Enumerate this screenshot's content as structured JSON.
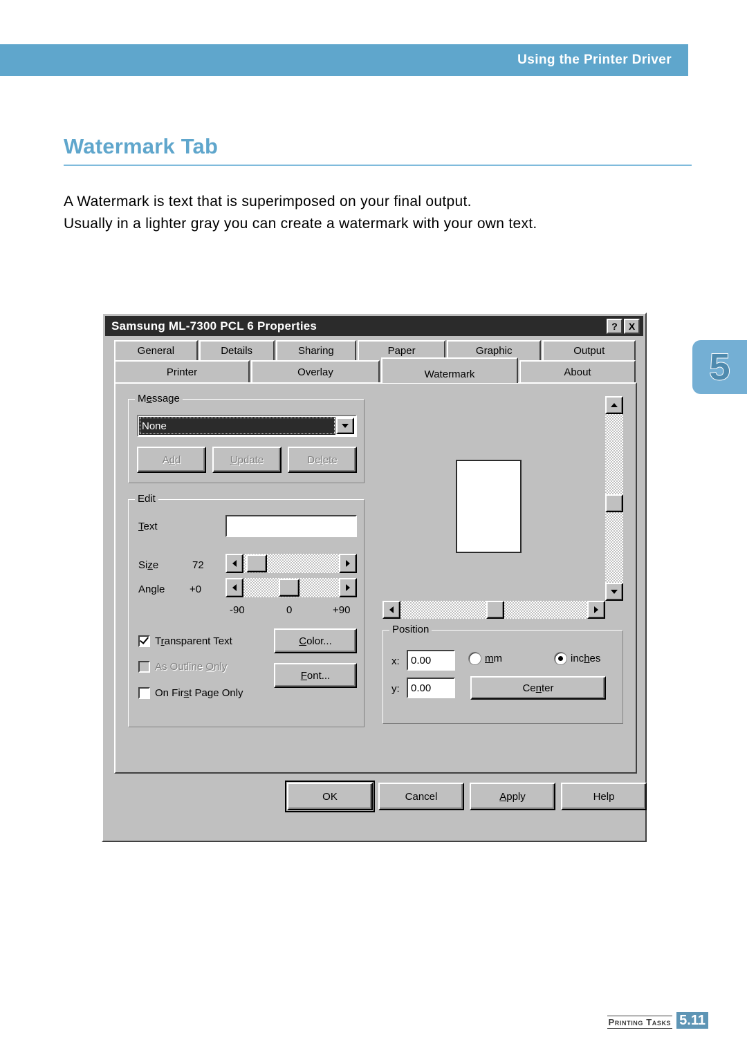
{
  "header": {
    "title": "Using the Printer Driver"
  },
  "page": {
    "title": "Watermark Tab",
    "body_line_1": "A Watermark is text that is superimposed on your final output.",
    "body_line_2": "Usually in a lighter gray you can create a watermark with your own text.",
    "chapter_number": "5",
    "footer_label": "Printing Tasks",
    "footer_page": "5.11",
    "accent_color": "#5FA6CC",
    "chapter_tab_color": "#74AFD4"
  },
  "dialog": {
    "title": "Samsung ML-7300 PCL 6 Properties",
    "titlebar_buttons": {
      "help": "?",
      "close": "X"
    },
    "tabs_row1": [
      {
        "label": "General",
        "active": false
      },
      {
        "label": "Details",
        "active": false
      },
      {
        "label": "Sharing",
        "active": false
      },
      {
        "label": "Paper",
        "active": false
      },
      {
        "label": "Graphic",
        "active": false
      },
      {
        "label": "Output",
        "active": false
      }
    ],
    "tabs_row2": [
      {
        "label": "Printer",
        "active": false
      },
      {
        "label": "Overlay",
        "active": false
      },
      {
        "label": "Watermark",
        "active": true
      },
      {
        "label": "About",
        "active": false
      }
    ],
    "message_group": {
      "legend": "Message",
      "combo_value": "None",
      "buttons": [
        {
          "label": "Add",
          "enabled": false
        },
        {
          "label": "Update",
          "enabled": false
        },
        {
          "label": "Delete",
          "enabled": false
        }
      ]
    },
    "edit_group": {
      "legend": "Edit",
      "text_label": "Text",
      "text_value": "",
      "size_label": "Size",
      "size_value": "72",
      "size_thumb_percent": 12,
      "angle_label": "Angle",
      "angle_value": "+0",
      "angle_thumb_percent": 48,
      "scale_min": "-90",
      "scale_mid": "0",
      "scale_max": "+90",
      "checkboxes": [
        {
          "label": "Transparent Text",
          "checked": true,
          "enabled": true
        },
        {
          "label": "As Outline Only",
          "checked": false,
          "enabled": false
        },
        {
          "label": "On First Page Only",
          "checked": false,
          "enabled": true
        }
      ],
      "color_button": "Color...",
      "font_button": "Font..."
    },
    "position_group": {
      "legend": "Position",
      "x_label": "x:",
      "x_value": "0.00",
      "y_label": "y:",
      "y_value": "0.00",
      "units": [
        {
          "label": "mm",
          "selected": false
        },
        {
          "label": "inches",
          "selected": true
        }
      ],
      "center_button": "Center"
    },
    "footer_buttons": [
      {
        "label": "OK",
        "default": true
      },
      {
        "label": "Cancel",
        "default": false
      },
      {
        "label": "Apply",
        "default": false
      },
      {
        "label": "Help",
        "default": false
      }
    ]
  }
}
